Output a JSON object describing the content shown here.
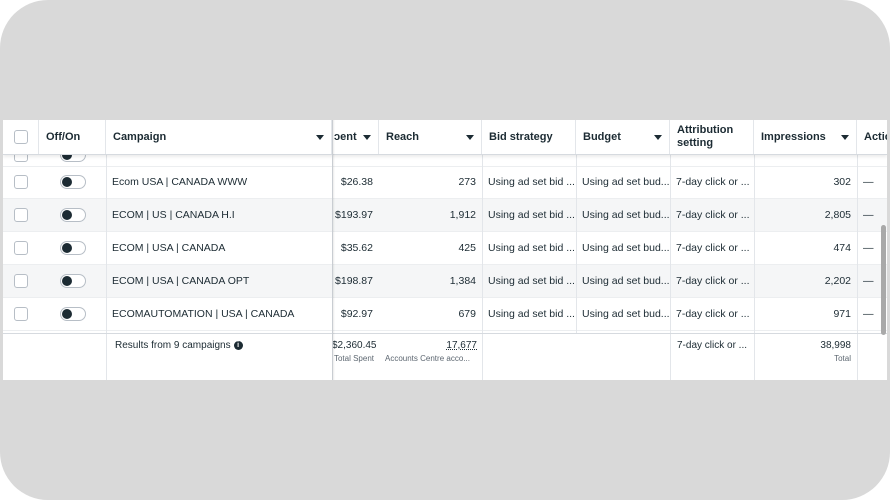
{
  "columns": {
    "off_on": "Off/On",
    "campaign": "Campaign",
    "spent": "ɔent",
    "reach": "Reach",
    "bid_strategy": "Bid strategy",
    "budget": "Budget",
    "attribution": "Attribution setting",
    "impressions": "Impressions",
    "actions": "Actio"
  },
  "rows": [
    {
      "campaign": "Ecom USA | CANADA WWW",
      "spent": "$26.38",
      "reach": "273",
      "bid": "Using ad set bid ...",
      "budget": "Using ad set bud...",
      "attribution": "7-day click or ...",
      "impressions": "302",
      "actions": "—"
    },
    {
      "campaign": "ECOM | US | CANADA H.I",
      "spent": "$193.97",
      "reach": "1,912",
      "bid": "Using ad set bid ...",
      "budget": "Using ad set bud...",
      "attribution": "7-day click or ...",
      "impressions": "2,805",
      "actions": "—"
    },
    {
      "campaign": "ECOM | USA | CANADA",
      "spent": "$35.62",
      "reach": "425",
      "bid": "Using ad set bid ...",
      "budget": "Using ad set bud...",
      "attribution": "7-day click or ...",
      "impressions": "474",
      "actions": "—"
    },
    {
      "campaign": "ECOM | USA | CANADA OPT",
      "spent": "$198.87",
      "reach": "1,384",
      "bid": "Using ad set bid ...",
      "budget": "Using ad set bud...",
      "attribution": "7-day click or ...",
      "impressions": "2,202",
      "actions": "—"
    },
    {
      "campaign": "ECOMAUTOMATION | USA | CANADA",
      "spent": "$92.97",
      "reach": "679",
      "bid": "Using ad set bid ...",
      "budget": "Using ad set bud...",
      "attribution": "7-day click or ...",
      "impressions": "971",
      "actions": "—"
    }
  ],
  "footer": {
    "results": "Results from 9 campaigns",
    "spent_total": "$2,360.45",
    "spent_sub": "Total Spent",
    "reach_total": "17,677",
    "reach_sub": "Accounts Centre acco...",
    "attribution": "7-day click or ...",
    "impressions_total": "38,998",
    "impressions_sub": "Total"
  },
  "colors": {
    "link": "#2e63b9",
    "text": "#1c2b33",
    "frame": "#d9d9d9"
  }
}
